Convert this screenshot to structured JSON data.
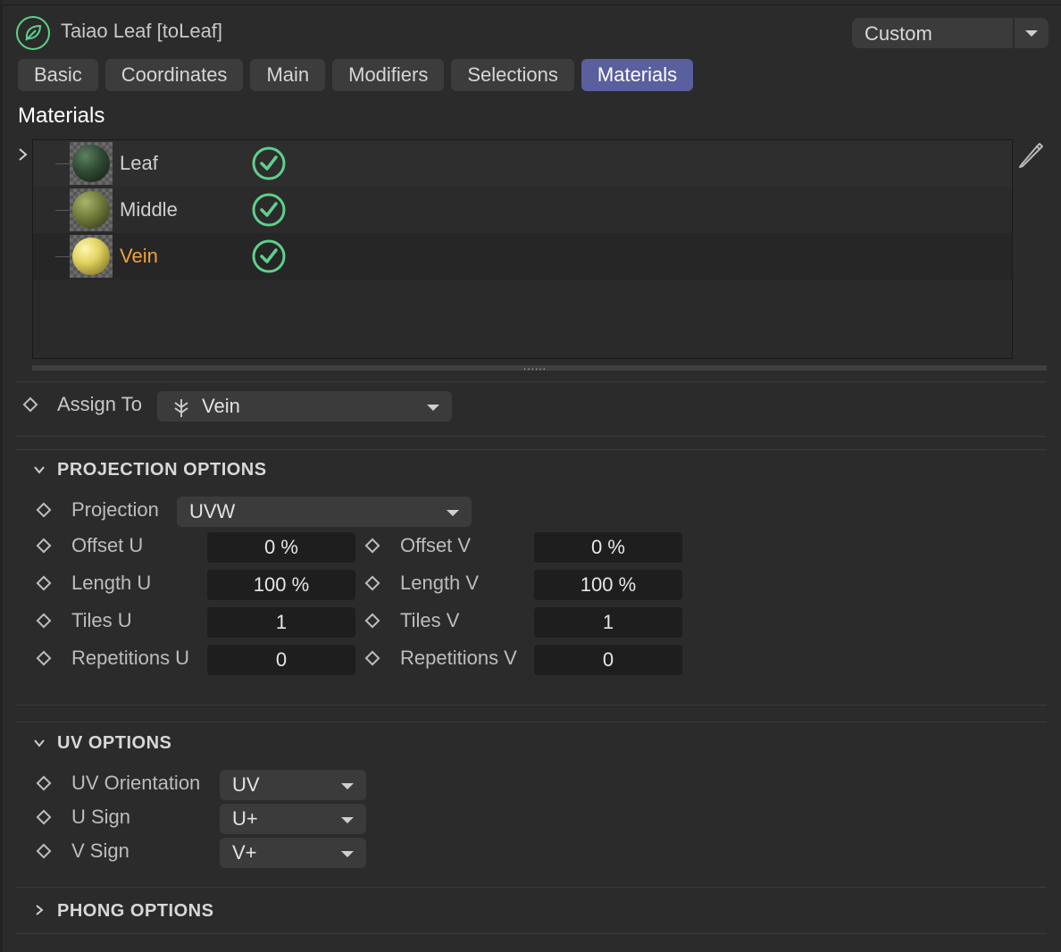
{
  "header": {
    "title": "Taiao Leaf [toLeaf]",
    "object_icon": "leaf-icon",
    "layout_preset": "Custom"
  },
  "tabs": [
    {
      "label": "Basic",
      "active": false
    },
    {
      "label": "Coordinates",
      "active": false
    },
    {
      "label": "Main",
      "active": false
    },
    {
      "label": "Modifiers",
      "active": false
    },
    {
      "label": "Selections",
      "active": false
    },
    {
      "label": "Materials",
      "active": true
    }
  ],
  "materials": {
    "section_title": "Materials",
    "items": [
      {
        "name": "Leaf",
        "enabled": true,
        "selected": false,
        "color": "#2f4a33"
      },
      {
        "name": "Middle",
        "enabled": true,
        "selected": false,
        "color": "#6f7a3a"
      },
      {
        "name": "Vein",
        "enabled": true,
        "selected": true,
        "color": "#e0d260"
      }
    ],
    "colors": {
      "check": "#5fd08c",
      "selected_text": "#f0a23a"
    }
  },
  "assign": {
    "label": "Assign To",
    "value": "Vein",
    "icon": "selection-tag-icon"
  },
  "projection": {
    "header": "PROJECTION OPTIONS",
    "expanded": true,
    "projection_label": "Projection",
    "projection_value": "UVW",
    "offset_u_label": "Offset U",
    "offset_u": "0 %",
    "offset_v_label": "Offset V",
    "offset_v": "0 %",
    "length_u_label": "Length U",
    "length_u": "100 %",
    "length_v_label": "Length V",
    "length_v": "100 %",
    "tiles_u_label": "Tiles U",
    "tiles_u": "1",
    "tiles_v_label": "Tiles V",
    "tiles_v": "1",
    "rep_u_label": "Repetitions U",
    "rep_u": "0",
    "rep_v_label": "Repetitions V",
    "rep_v": "0"
  },
  "uv": {
    "header": "UV OPTIONS",
    "expanded": true,
    "orientation_label": "UV Orientation",
    "orientation_value": "UV",
    "u_sign_label": "U Sign",
    "u_sign_value": "U+",
    "v_sign_label": "V Sign",
    "v_sign_value": "V+"
  },
  "phong": {
    "header": "PHONG OPTIONS",
    "expanded": false
  },
  "colors": {
    "background": "#2b2b2b",
    "active_tab": "#5a5f9e",
    "field_bg": "#1e1e1e"
  }
}
